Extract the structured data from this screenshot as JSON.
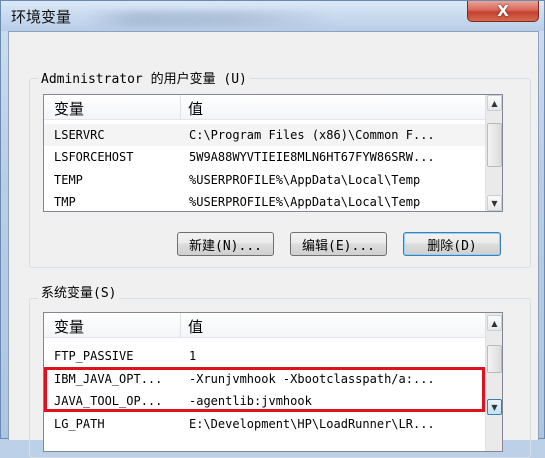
{
  "window": {
    "title": "环境变量",
    "close_label": "X"
  },
  "user_vars": {
    "group_label": "Administrator 的用户变量 (U)",
    "columns": [
      "变量",
      "值"
    ],
    "rows": [
      {
        "name": "LSERVRC",
        "value": "C:\\Program Files (x86)\\Common F..."
      },
      {
        "name": "LSFORCEHOST",
        "value": "5W9A88WYVTIEIE8MLN6HT67FYW86SRW..."
      },
      {
        "name": "TEMP",
        "value": "%USERPROFILE%\\AppData\\Local\\Temp"
      },
      {
        "name": "TMP",
        "value": "%USERPROFILE%\\AppData\\Local\\Temp"
      }
    ],
    "buttons": {
      "new": "新建(N)...",
      "edit": "编辑(E)...",
      "delete": "删除(D)"
    }
  },
  "system_vars": {
    "group_label": "系统变量(S)",
    "columns": [
      "变量",
      "值"
    ],
    "rows": [
      {
        "name": "FTP_PASSIVE",
        "value": "1"
      },
      {
        "name": "IBM_JAVA_OPT...",
        "value": "-Xrunjvmhook -Xbootclasspath/a:..."
      },
      {
        "name": "JAVA_TOOL_OP...",
        "value": "-agentlib:jvmhook"
      },
      {
        "name": "LG_PATH",
        "value": "E:\\Development\\HP\\LoadRunner\\LR..."
      }
    ]
  },
  "colors": {
    "highlight_box": "#e0111d",
    "close_button": "#c4412f"
  }
}
